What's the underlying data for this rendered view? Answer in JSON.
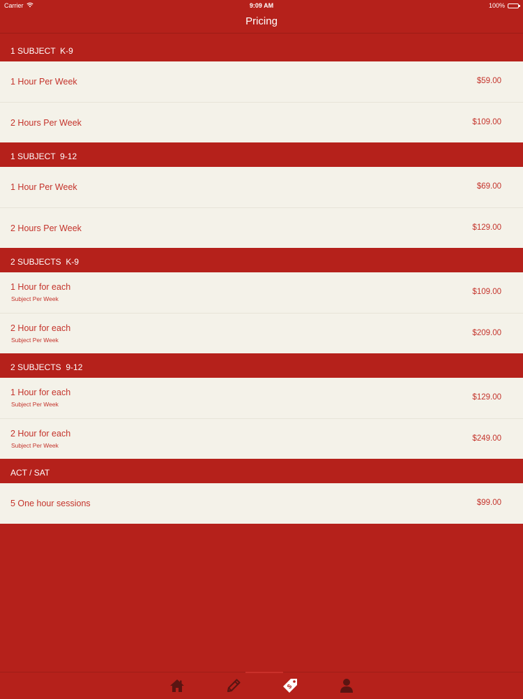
{
  "status_bar": {
    "carrier": "Carrier",
    "time": "9:09 AM",
    "battery": "100%"
  },
  "nav": {
    "title": "Pricing"
  },
  "sections": [
    {
      "header": "1 SUBJECT  K-9",
      "rows": [
        {
          "title": "1 Hour Per Week",
          "subtitle": "",
          "price": "$59.00"
        },
        {
          "title": "2 Hours Per Week",
          "subtitle": "",
          "price": "$109.00"
        }
      ]
    },
    {
      "header": "1 SUBJECT  9-12",
      "rows": [
        {
          "title": "1 Hour Per Week",
          "subtitle": "",
          "price": "$69.00"
        },
        {
          "title": "2 Hours Per Week",
          "subtitle": "",
          "price": "$129.00"
        }
      ]
    },
    {
      "header": "2 SUBJECTS  K-9",
      "rows": [
        {
          "title": "1 Hour for each",
          "subtitle": "Subject Per Week",
          "price": "$109.00"
        },
        {
          "title": "2 Hour for each",
          "subtitle": "Subject Per Week",
          "price": "$209.00"
        }
      ]
    },
    {
      "header": "2 SUBJECTS  9-12",
      "rows": [
        {
          "title": "1 Hour for each",
          "subtitle": "Subject Per Week",
          "price": "$129.00"
        },
        {
          "title": "2 Hour for each",
          "subtitle": "Subject Per Week",
          "price": "$249.00"
        }
      ]
    },
    {
      "header": "ACT / SAT",
      "rows": [
        {
          "title": "5 One hour sessions",
          "subtitle": "",
          "price": "$99.00"
        }
      ]
    }
  ],
  "tab_bar": {
    "items": [
      {
        "icon": "home-icon",
        "selected": false
      },
      {
        "icon": "pencil-icon",
        "selected": false
      },
      {
        "icon": "price-tag-icon",
        "selected": true
      },
      {
        "icon": "person-icon",
        "selected": false
      }
    ]
  },
  "colors": {
    "brand_red": "#B5211B",
    "row_background": "#F4F2E9",
    "text_red": "#C4332B",
    "icon_dark": "#5a1512"
  }
}
